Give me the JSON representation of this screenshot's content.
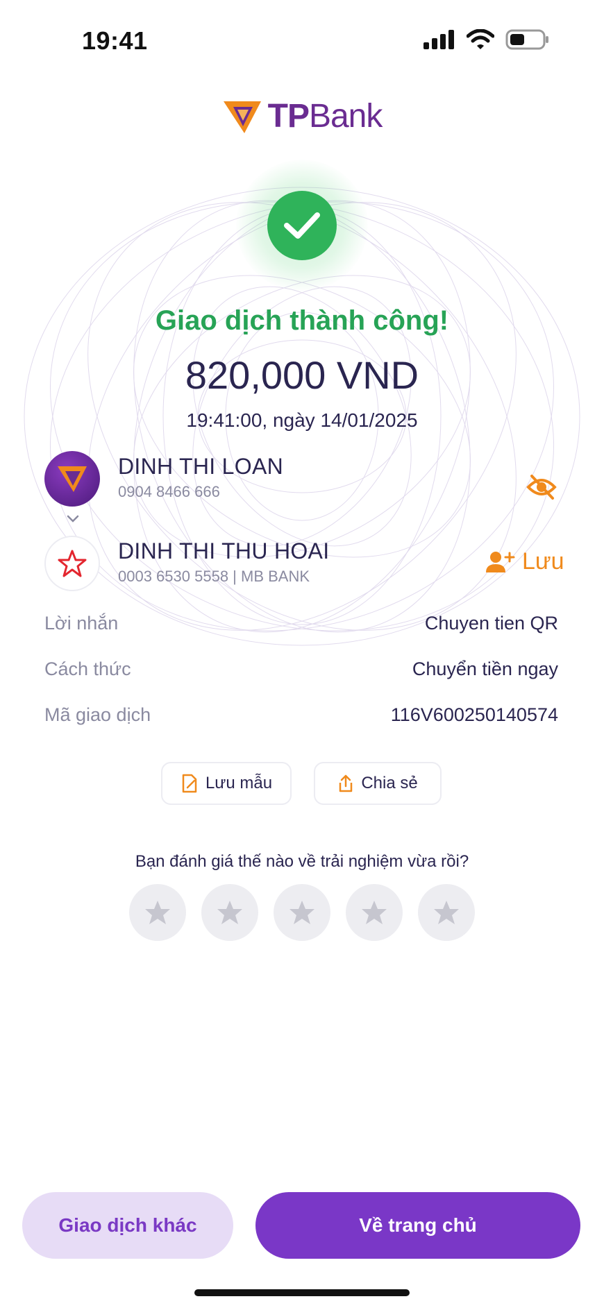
{
  "status_bar": {
    "time": "19:41"
  },
  "brand": {
    "logo_tp": "TP",
    "logo_bank": "Bank",
    "accent": "#6a2c91",
    "logo_orange": "#f08a1c"
  },
  "result": {
    "title": "Giao dịch thành công!",
    "amount": "820,000 VND",
    "datetime": "19:41:00, ngày 14/01/2025",
    "success_color": "#27a356"
  },
  "sender": {
    "name": "DINH THI LOAN",
    "account": "0904 8466 666"
  },
  "receiver": {
    "name": "DINH THI THU HOAI",
    "account": "0003 6530 5558 | MB BANK",
    "save_label": "Lưu"
  },
  "details": [
    {
      "label": "Lời nhắn",
      "value": "Chuyen tien QR"
    },
    {
      "label": "Cách thức",
      "value": "Chuyển tiền ngay"
    },
    {
      "label": "Mã giao dịch",
      "value": "116V600250140574"
    }
  ],
  "actions": {
    "save_template": "Lưu mẫu",
    "share": "Chia sẻ"
  },
  "rating": {
    "question": "Bạn đánh giá thế nào về trải nghiệm vừa rồi?",
    "stars": 5,
    "selected": 0
  },
  "bottom": {
    "other_transaction": "Giao dịch khác",
    "home": "Về trang chủ",
    "primary_color": "#7a37c7"
  }
}
